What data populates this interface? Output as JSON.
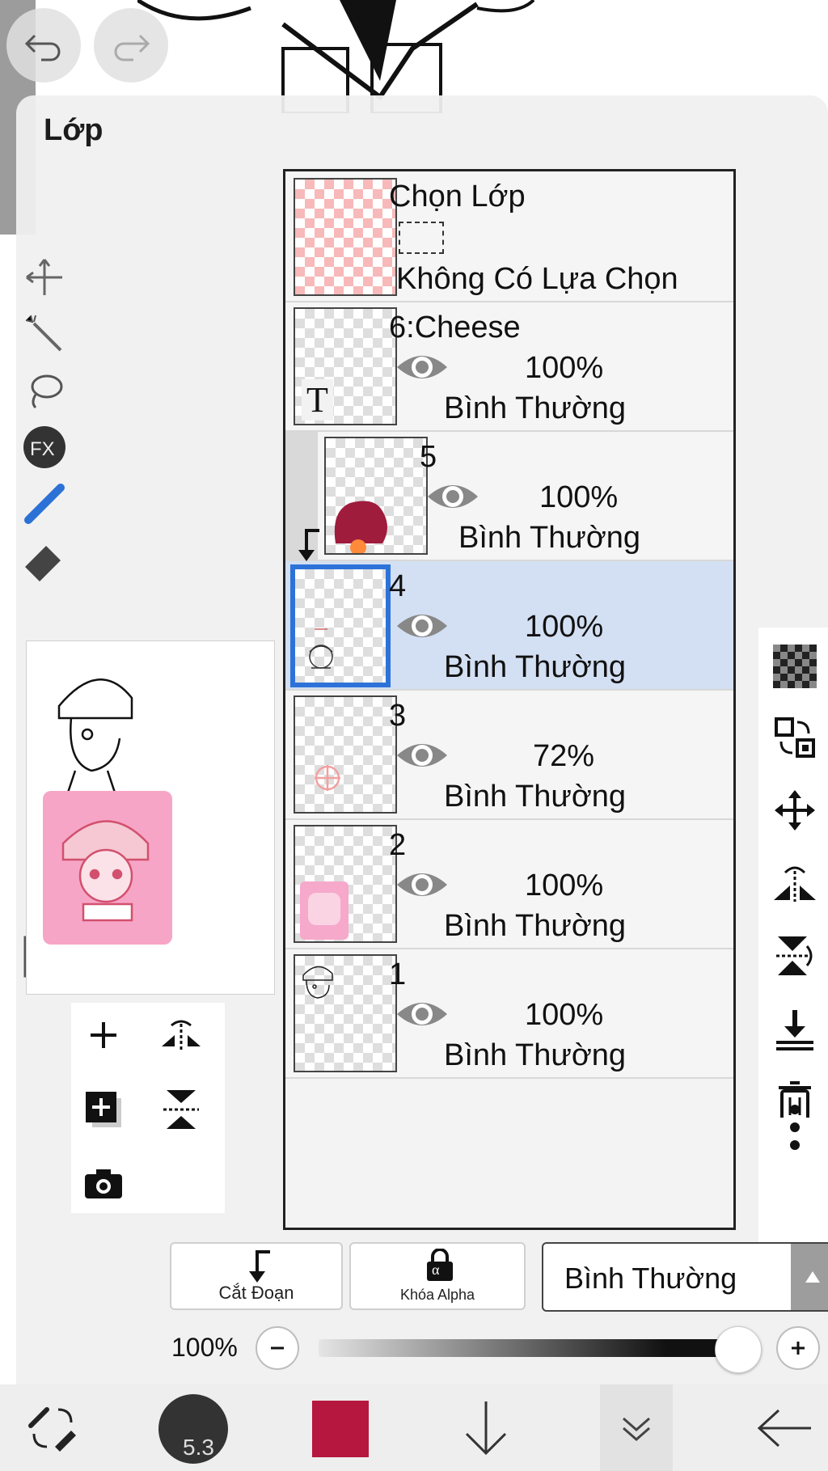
{
  "panel": {
    "title": "Lớp"
  },
  "selection_layer": {
    "title": "Chọn Lớp",
    "status": "Không Có Lựa Chọn"
  },
  "layers": [
    {
      "name": "6:Cheese",
      "opacity": "100%",
      "blend": "Bình Thường",
      "visible": true,
      "type": "text",
      "type_glyph": "T"
    },
    {
      "name": "5",
      "opacity": "100%",
      "blend": "Bình Thường",
      "visible": true,
      "clipped": true
    },
    {
      "name": "4",
      "opacity": "100%",
      "blend": "Bình Thường",
      "visible": true,
      "selected": true
    },
    {
      "name": "3",
      "opacity": "72%",
      "blend": "Bình Thường",
      "visible": true
    },
    {
      "name": "2",
      "opacity": "100%",
      "blend": "Bình Thường",
      "visible": true
    },
    {
      "name": "1",
      "opacity": "100%",
      "blend": "Bình Thường",
      "visible": true
    }
  ],
  "controls": {
    "clipping_label": "Cắt Đoạn",
    "alpha_lock_label": "Khóa Alpha",
    "alpha_glyph": "α",
    "blend_mode": "Bình Thường",
    "opacity_value": "100%",
    "opacity_level": 1.0
  },
  "brush": {
    "size": "5.3"
  },
  "colors": {
    "accent": "#2d72d9",
    "selected_row": "#d3dff2",
    "current_color": "#b5173e"
  },
  "icons": {
    "undo": "undo-icon",
    "redo": "redo-icon",
    "add_layer": "plus-icon",
    "duplicate": "duplicate-icon",
    "camera": "camera-icon",
    "transparency": "checker-icon",
    "move": "move-icon",
    "flip_h": "flip-horizontal-icon",
    "flip_v": "flip-vertical-icon",
    "merge_down": "merge-down-icon",
    "delete": "trash-icon",
    "more": "more-vertical-icon"
  }
}
